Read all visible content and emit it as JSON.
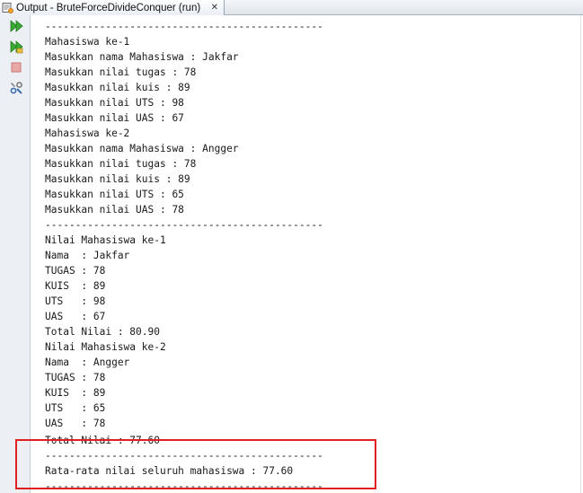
{
  "tab": {
    "title": "Output - BruteForceDivideConquer (run)",
    "close_glyph": "✕"
  },
  "toolbar": {
    "buttons": [
      "rerun-icon",
      "rerun-with-input-icon",
      "stop-icon",
      "settings-icon"
    ]
  },
  "console": {
    "lines": [
      "----------------------------------------------",
      "Mahasiswa ke-1",
      "Masukkan nama Mahasiswa : Jakfar",
      "Masukkan nilai tugas : 78",
      "Masukkan nilai kuis : 89",
      "Masukkan nilai UTS : 98",
      "Masukkan nilai UAS : 67",
      "Mahasiswa ke-2",
      "Masukkan nama Mahasiswa : Angger",
      "Masukkan nilai tugas : 78",
      "Masukkan nilai kuis : 89",
      "Masukkan nilai UTS : 65",
      "Masukkan nilai UAS : 78",
      "----------------------------------------------",
      "Nilai Mahasiswa ke-1",
      "Nama  : Jakfar",
      "TUGAS : 78",
      "KUIS  : 89",
      "UTS   : 98",
      "UAS   : 67",
      "Total Nilai : 80.90",
      "Nilai Mahasiswa ke-2",
      "Nama  : Angger",
      "TUGAS : 78",
      "KUIS  : 89",
      "UTS   : 65",
      "UAS   : 78",
      "Total Nilai : 77.60",
      "----------------------------------------------",
      "Rata-rata nilai seluruh mahasiswa : 77.60",
      "----------------------------------------------"
    ]
  },
  "colors": {
    "highlight": "#e02020",
    "run_green": "#3aa832"
  }
}
